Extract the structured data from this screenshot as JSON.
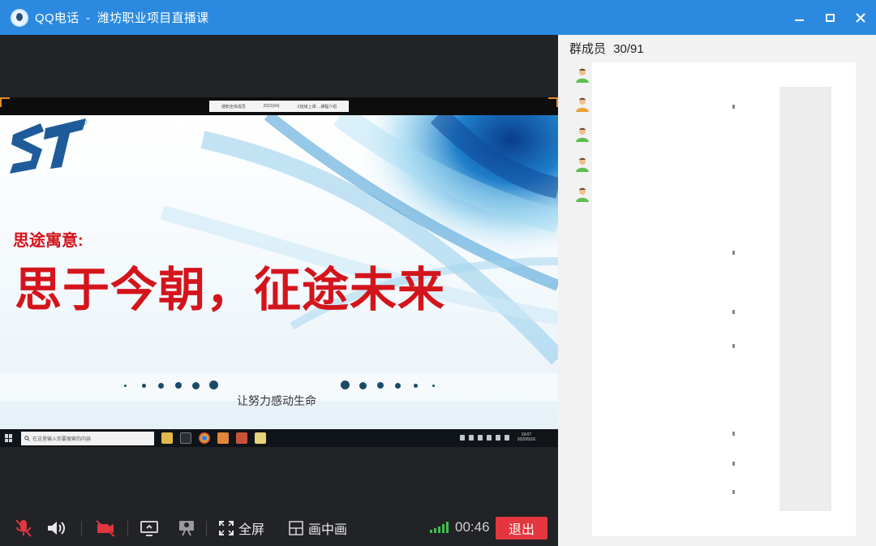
{
  "window": {
    "app_name": "QQ电话",
    "separator": "-",
    "group_name": "潍坊职业项目直播课"
  },
  "slide": {
    "topbar_items": [
      "通知全体成员",
      "2021(04)",
      "X班级上课 ...课程介绍"
    ],
    "logo_text": "ST",
    "subtitle": "思途寓意:",
    "headline": "思于今朝，征途未来",
    "tagline": "让努力感动生命"
  },
  "shared_taskbar": {
    "search_placeholder": "在这里输入你要搜索的内容",
    "clock_time": "19:07",
    "clock_date": "2020/5/16"
  },
  "toolbar": {
    "fullscreen_label": "全屏",
    "pip_label": "画中画",
    "call_duration": "00:46",
    "exit_label": "退出"
  },
  "members": {
    "header_label": "群成员",
    "online_count": "30",
    "total_count": "91",
    "count_separator": "/",
    "visible_avatars": 5
  },
  "colors": {
    "titlebar": "#2b8ae0",
    "exit_button": "#e3363f",
    "slide_text": "#d4141b",
    "signal": "#3fbf4f"
  }
}
